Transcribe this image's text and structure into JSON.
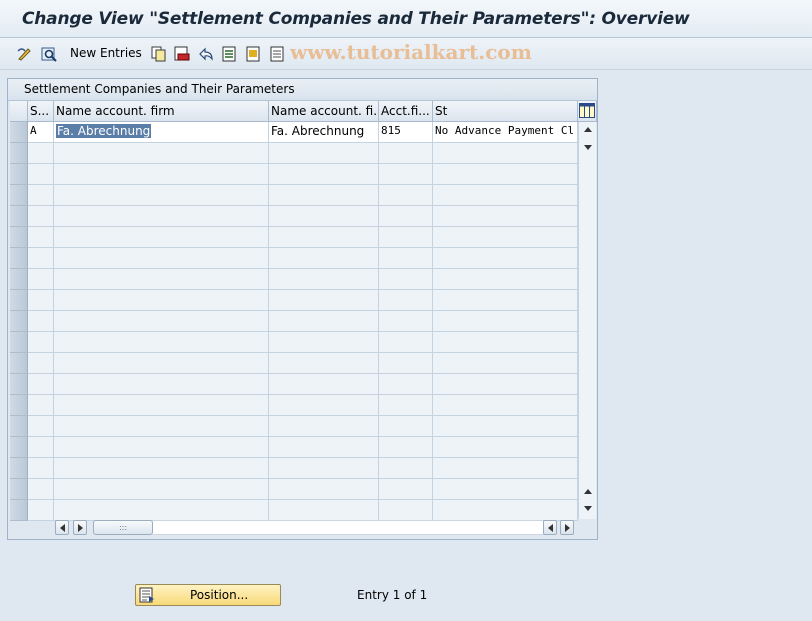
{
  "window": {
    "title": "Change View \"Settlement Companies and Their Parameters\": Overview"
  },
  "toolbar": {
    "new_entries_label": "New Entries",
    "icons": [
      "display-change-icon",
      "select-all-icon",
      "copy-icon",
      "delete-icon",
      "undo-icon",
      "select-block-icon",
      "deselect-all-icon",
      "print-icon"
    ],
    "watermark": "www.tutorialkart.com"
  },
  "table": {
    "title": "Settlement Companies and Their Parameters",
    "columns": [
      "S...",
      "Name account. firm",
      "Name account. fi...",
      "Acct.fi...",
      "St"
    ],
    "rows": [
      {
        "s": "A",
        "name_firm": "Fa. Abrechnung",
        "name_fi": "Fa. Abrechnung",
        "acct": "815",
        "st": "No Advance Payment Cl"
      }
    ]
  },
  "footer": {
    "position_label": "Position...",
    "entry_text": "Entry 1 of 1"
  },
  "colors": {
    "accent": "#f7d978",
    "selection": "#5b7ea8",
    "background": "#dfe8f1"
  }
}
